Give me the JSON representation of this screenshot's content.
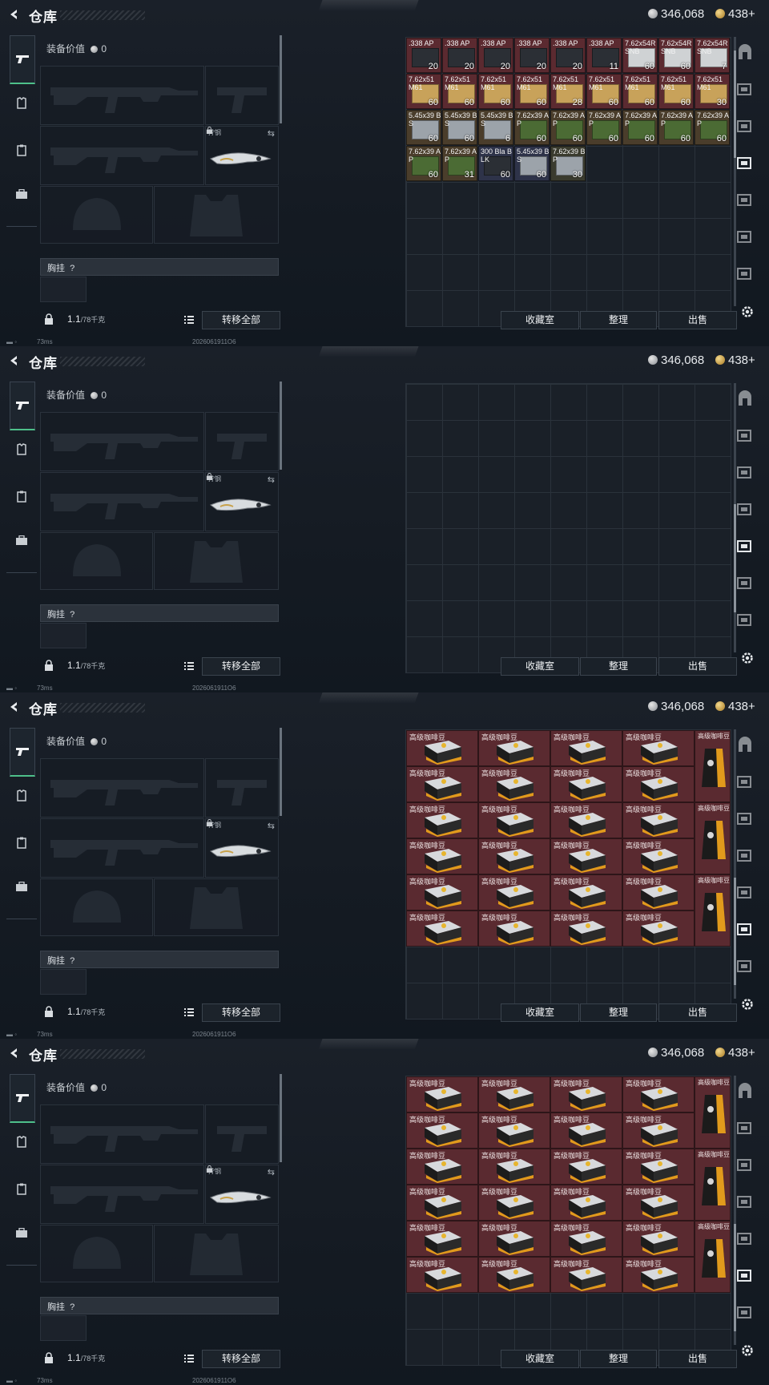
{
  "title": "仓库",
  "currency": {
    "silver": "346,068",
    "gold": "438",
    "gold_plus": "+"
  },
  "equipment": {
    "value_label": "装备价值",
    "value": "0",
    "melee_label": "拧钢",
    "chest_label": "胸挂",
    "chest_value": "?",
    "weight": "1.1",
    "weight_max": "/78千克",
    "transfer_all": "转移全部"
  },
  "status": {
    "ping": "73ms",
    "build": "2026061911O6"
  },
  "buttons": {
    "collection": "收藏室",
    "sort": "整理",
    "sell": "出售"
  },
  "screens": [
    {
      "active_tab": 3,
      "scroll_thumb": [
        0.05,
        0.45
      ],
      "items": [
        {
          "name": ".338 AP",
          "count": "20",
          "color": "#5b2a30",
          "art": "ammo-dark"
        },
        {
          "name": ".338 AP",
          "count": "20",
          "color": "#5b2a30",
          "art": "ammo-dark"
        },
        {
          "name": ".338 AP",
          "count": "20",
          "color": "#5b2a30",
          "art": "ammo-dark"
        },
        {
          "name": ".338 AP",
          "count": "20",
          "color": "#5b2a30",
          "art": "ammo-dark"
        },
        {
          "name": ".338 AP",
          "count": "20",
          "color": "#5b2a30",
          "art": "ammo-dark"
        },
        {
          "name": ".338 AP",
          "count": "11",
          "color": "#5b2a30",
          "art": "ammo-dark"
        },
        {
          "name": "7.62x54R SNB",
          "count": "60",
          "color": "#5b2a30",
          "art": "ammo-white"
        },
        {
          "name": "7.62x54R SNB",
          "count": "60",
          "color": "#5b2a30",
          "art": "ammo-white"
        },
        {
          "name": "7.62x54R SNB",
          "count": "7",
          "color": "#5b2a30",
          "art": "ammo-white"
        },
        {
          "name": "7.62x51 M61",
          "count": "60",
          "color": "#5b2a30",
          "art": "ammo-box"
        },
        {
          "name": "7.62x51 M61",
          "count": "60",
          "color": "#5b2a30",
          "art": "ammo-box"
        },
        {
          "name": "7.62x51 M61",
          "count": "60",
          "color": "#5b2a30",
          "art": "ammo-box"
        },
        {
          "name": "7.62x51 M61",
          "count": "60",
          "color": "#5b2a30",
          "art": "ammo-box"
        },
        {
          "name": "7.62x51 M61",
          "count": "28",
          "color": "#5b2a30",
          "art": "ammo-box"
        },
        {
          "name": "7.62x51 M61",
          "count": "60",
          "color": "#5b2a30",
          "art": "ammo-box"
        },
        {
          "name": "7.62x51 M61",
          "count": "60",
          "color": "#5b2a30",
          "art": "ammo-box"
        },
        {
          "name": "7.62x51 M61",
          "count": "60",
          "color": "#5b2a30",
          "art": "ammo-box"
        },
        {
          "name": "7.62x51 M61",
          "count": "30",
          "color": "#5b2a30",
          "art": "ammo-box"
        },
        {
          "name": "5.45x39 BS",
          "count": "60",
          "color": "#4a3d2b",
          "art": "ammo-silver"
        },
        {
          "name": "5.45x39 BS",
          "count": "60",
          "color": "#4a3d2b",
          "art": "ammo-silver"
        },
        {
          "name": "5.45x39 BS",
          "count": "6",
          "color": "#4a3d2b",
          "art": "ammo-silver"
        },
        {
          "name": "7.62x39 AP",
          "count": "60",
          "color": "#4a3d2b",
          "art": "ammo-green"
        },
        {
          "name": "7.62x39 AP",
          "count": "60",
          "color": "#4a3d2b",
          "art": "ammo-green"
        },
        {
          "name": "7.62x39 AP",
          "count": "60",
          "color": "#4a3d2b",
          "art": "ammo-green"
        },
        {
          "name": "7.62x39 AP",
          "count": "60",
          "color": "#4a3d2b",
          "art": "ammo-green"
        },
        {
          "name": "7.62x39 AP",
          "count": "60",
          "color": "#4a3d2b",
          "art": "ammo-green"
        },
        {
          "name": "7.62x39 AP",
          "count": "60",
          "color": "#4a3d2b",
          "art": "ammo-green"
        },
        {
          "name": "7.62x39 AP",
          "count": "60",
          "color": "#4a3d2b",
          "art": "ammo-green"
        },
        {
          "name": "7.62x39 AP",
          "count": "31",
          "color": "#4a3d2b",
          "art": "ammo-green"
        },
        {
          "name": "300 Bla BLK",
          "count": "60",
          "color": "#2e3349",
          "art": "ammo-dark"
        },
        {
          "name": "5.45x39 BS",
          "count": "60",
          "color": "#2e3349",
          "art": "ammo-silver"
        },
        {
          "name": "7.62x39 BP",
          "count": "30",
          "color": "#3a3b2e",
          "art": "ammo-silver"
        }
      ]
    },
    {
      "active_tab": 4,
      "scroll_thumb": [
        0.45,
        0.85
      ],
      "items": []
    },
    {
      "active_tab": 5,
      "scroll_thumb": [
        0.55,
        0.95
      ],
      "coffee_label": "高级咖啡豆",
      "coffee": true
    },
    {
      "active_tab": 5,
      "scroll_thumb": [
        0.55,
        0.95
      ],
      "coffee_label": "高级咖啡豆",
      "coffee": true
    }
  ],
  "icons": [
    "back-arrow-icon",
    "pistol-icon",
    "armor-icon",
    "clipboard-icon",
    "briefcase-icon",
    "lock-icon",
    "list-icon",
    "gear-icon",
    "exit-icon",
    "stash-tab-icon"
  ]
}
